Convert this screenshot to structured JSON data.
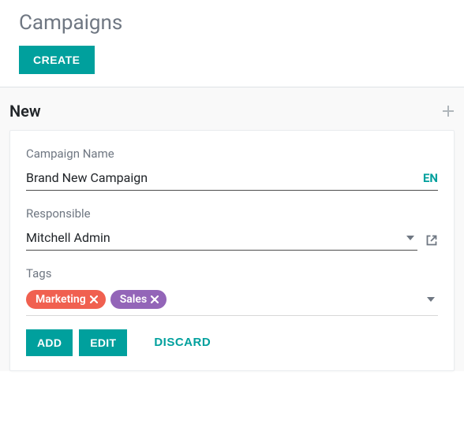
{
  "header": {
    "title": "Campaigns",
    "create_label": "CREATE"
  },
  "column": {
    "title": "New"
  },
  "card": {
    "campaign_name": {
      "label": "Campaign Name",
      "value": "Brand New Campaign",
      "lang": "EN"
    },
    "responsible": {
      "label": "Responsible",
      "value": "Mitchell Admin"
    },
    "tags": {
      "label": "Tags",
      "items": [
        {
          "name": "Marketing",
          "color": "#f06050"
        },
        {
          "name": "Sales",
          "color": "#9365b8"
        }
      ]
    },
    "actions": {
      "add": "ADD",
      "edit": "EDIT",
      "discard": "DISCARD"
    }
  }
}
